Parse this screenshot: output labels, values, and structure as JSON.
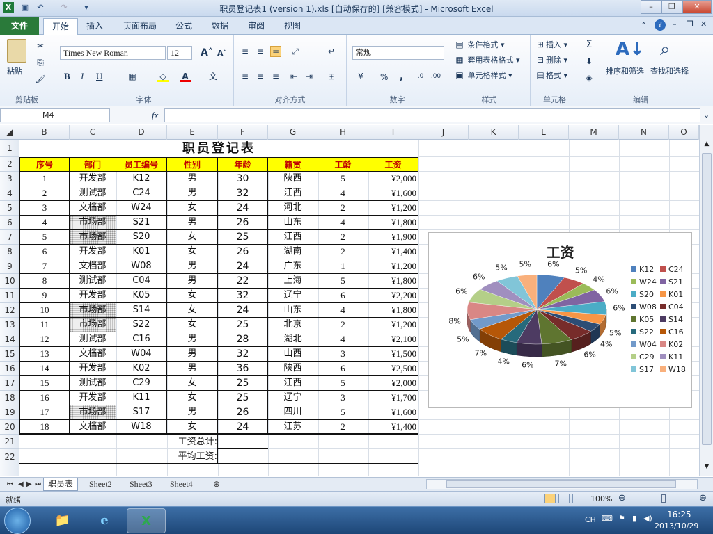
{
  "window": {
    "title": "职员登记表1 (version 1).xls [自动保存的] [兼容模式] - Microsoft Excel"
  },
  "tabs": [
    "文件",
    "开始",
    "插入",
    "页面布局",
    "公式",
    "数据",
    "审阅",
    "视图"
  ],
  "ribbon": {
    "clipboard": {
      "label": "剪贴板",
      "paste": "粘贴"
    },
    "font": {
      "label": "字体",
      "name": "Times New Roman",
      "size": "12",
      "bold": "B",
      "italic": "I",
      "underline": "U"
    },
    "alignment": {
      "label": "对齐方式"
    },
    "number": {
      "label": "数字",
      "format": "常规",
      "percent": "%",
      "comma": ","
    },
    "styles": {
      "label": "样式",
      "cond": "条件格式",
      "table": "套用表格格式",
      "cell": "单元格样式"
    },
    "cells": {
      "label": "单元格",
      "insert": "插入",
      "delete": "删除",
      "format": "格式"
    },
    "editing": {
      "label": "编辑",
      "sort": "排序和筛选",
      "find": "查找和选择"
    }
  },
  "formula_bar": {
    "name_box": "M4",
    "fx": "fx",
    "value": ""
  },
  "columns": [
    "B",
    "C",
    "D",
    "E",
    "F",
    "G",
    "H",
    "I",
    "J",
    "K",
    "L",
    "M",
    "N",
    "O"
  ],
  "rows": [
    "1",
    "2",
    "3",
    "4",
    "5",
    "6",
    "7",
    "8",
    "9",
    "10",
    "11",
    "12",
    "13",
    "14",
    "15",
    "16",
    "17",
    "18",
    "19",
    "20",
    "21",
    "22"
  ],
  "sheet": {
    "title": "职员登记表",
    "headers": [
      "序号",
      "部门",
      "员工编号",
      "性别",
      "年龄",
      "籍贯",
      "工龄",
      "工资"
    ],
    "data": [
      [
        "1",
        "开发部",
        "K12",
        "男",
        "30",
        "陕西",
        "5",
        "¥2,000"
      ],
      [
        "2",
        "测试部",
        "C24",
        "男",
        "32",
        "江西",
        "4",
        "¥1,600"
      ],
      [
        "3",
        "文档部",
        "W24",
        "女",
        "24",
        "河北",
        "2",
        "¥1,200"
      ],
      [
        "4",
        "市场部",
        "S21",
        "男",
        "26",
        "山东",
        "4",
        "¥1,800"
      ],
      [
        "5",
        "市场部",
        "S20",
        "女",
        "25",
        "江西",
        "2",
        "¥1,900"
      ],
      [
        "6",
        "开发部",
        "K01",
        "女",
        "26",
        "湖南",
        "2",
        "¥1,400"
      ],
      [
        "7",
        "文档部",
        "W08",
        "男",
        "24",
        "广东",
        "1",
        "¥1,200"
      ],
      [
        "8",
        "测试部",
        "C04",
        "男",
        "22",
        "上海",
        "5",
        "¥1,800"
      ],
      [
        "9",
        "开发部",
        "K05",
        "女",
        "32",
        "辽宁",
        "6",
        "¥2,200"
      ],
      [
        "10",
        "市场部",
        "S14",
        "女",
        "24",
        "山东",
        "4",
        "¥1,800"
      ],
      [
        "11",
        "市场部",
        "S22",
        "女",
        "25",
        "北京",
        "2",
        "¥1,200"
      ],
      [
        "12",
        "测试部",
        "C16",
        "男",
        "28",
        "湖北",
        "4",
        "¥2,100"
      ],
      [
        "13",
        "文档部",
        "W04",
        "男",
        "32",
        "山西",
        "3",
        "¥1,500"
      ],
      [
        "14",
        "开发部",
        "K02",
        "男",
        "36",
        "陕西",
        "6",
        "¥2,500"
      ],
      [
        "15",
        "测试部",
        "C29",
        "女",
        "25",
        "江西",
        "5",
        "¥2,000"
      ],
      [
        "16",
        "开发部",
        "K11",
        "女",
        "25",
        "辽宁",
        "3",
        "¥1,700"
      ],
      [
        "17",
        "市场部",
        "S17",
        "男",
        "26",
        "四川",
        "5",
        "¥1,600"
      ],
      [
        "18",
        "文档部",
        "W18",
        "女",
        "24",
        "江苏",
        "2",
        "¥1,400"
      ]
    ],
    "total_label": "工资总计:",
    "avg_label": "平均工资:"
  },
  "chart_data": {
    "type": "pie",
    "title": "工资",
    "categories": [
      "K12",
      "C24",
      "W24",
      "S21",
      "S20",
      "K01",
      "W08",
      "C04",
      "K05",
      "S14",
      "S22",
      "C16",
      "W04",
      "K02",
      "C29",
      "K11",
      "S17",
      "W18"
    ],
    "values": [
      2000,
      1600,
      1200,
      1800,
      1900,
      1400,
      1200,
      1800,
      2200,
      1800,
      1200,
      2100,
      1500,
      2500,
      2000,
      1700,
      1600,
      1400
    ],
    "labels": [
      "6%",
      "5%",
      "4%",
      "6%",
      "6%",
      "5%",
      "4%",
      "6%",
      "7%",
      "6%",
      "4%",
      "7%",
      "5%",
      "8%",
      "6%",
      "6%",
      "5%",
      "5%"
    ],
    "colors": [
      "#4f81bd",
      "#c0504d",
      "#9bbb59",
      "#8064a2",
      "#4bacc6",
      "#f79646",
      "#2c4d75",
      "#772c2a",
      "#5f7530",
      "#4d3b62",
      "#276a7c",
      "#b65708",
      "#729aca",
      "#d98785",
      "#b4cf88",
      "#a08fbf",
      "#81c5d8",
      "#f9b07c"
    ],
    "legend": "right"
  },
  "sheet_tabs": [
    "职员表",
    "Sheet2",
    "Sheet3",
    "Sheet4"
  ],
  "status": {
    "ready": "就绪",
    "zoom": "100%"
  },
  "taskbar": {
    "lang": "CH",
    "time": "16:25",
    "date": "2013/10/29"
  }
}
